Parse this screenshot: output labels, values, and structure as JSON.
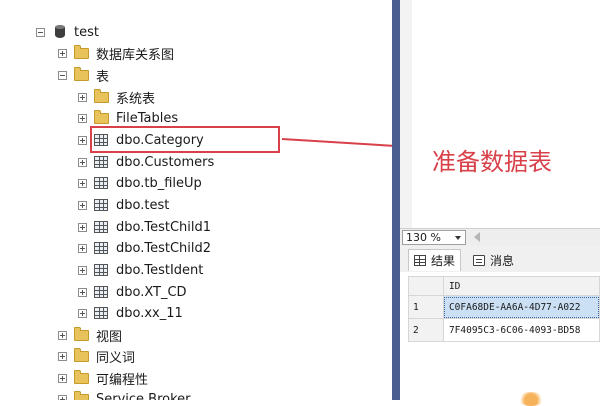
{
  "tree": {
    "database": "test",
    "nodes": [
      {
        "label": "数据库关系图",
        "icon": "folder-icon",
        "state": "collapsed"
      },
      {
        "label": "表",
        "icon": "folder-icon",
        "state": "expanded"
      },
      {
        "label": "系统表",
        "icon": "folder-icon",
        "state": "collapsed"
      },
      {
        "label": "FileTables",
        "icon": "folder-icon",
        "state": "collapsed"
      },
      {
        "label": "dbo.Category",
        "icon": "table-icon",
        "state": "collapsed"
      },
      {
        "label": "dbo.Customers",
        "icon": "table-icon",
        "state": "collapsed"
      },
      {
        "label": "dbo.tb_fileUp",
        "icon": "table-icon",
        "state": "collapsed"
      },
      {
        "label": "dbo.test",
        "icon": "table-icon",
        "state": "collapsed"
      },
      {
        "label": "dbo.TestChild1",
        "icon": "table-icon",
        "state": "collapsed"
      },
      {
        "label": "dbo.TestChild2",
        "icon": "table-icon",
        "state": "collapsed"
      },
      {
        "label": "dbo.TestIdent",
        "icon": "table-icon",
        "state": "collapsed"
      },
      {
        "label": "dbo.XT_CD",
        "icon": "table-icon",
        "state": "collapsed"
      },
      {
        "label": "dbo.xx_11",
        "icon": "table-icon",
        "state": "collapsed"
      },
      {
        "label": "视图",
        "icon": "folder-icon",
        "state": "collapsed"
      },
      {
        "label": "同义词",
        "icon": "folder-icon",
        "state": "collapsed"
      },
      {
        "label": "可编程性",
        "icon": "folder-icon",
        "state": "collapsed"
      },
      {
        "label": "Service Broker",
        "icon": "folder-icon",
        "state": "collapsed"
      }
    ]
  },
  "annotation": {
    "callout": "准备数据表",
    "colors": {
      "accent": "#d9414a"
    }
  },
  "editor": {
    "zoom": "130 %"
  },
  "results": {
    "tabs": {
      "results": "结果",
      "messages": "消息"
    },
    "column": "ID",
    "rows": [
      {
        "n": "1",
        "id": "C0FA68DE-AA6A-4D77-A022"
      },
      {
        "n": "2",
        "id": "7F4095C3-6C06-4093-BD58"
      }
    ]
  },
  "colors": {
    "splitter": "#4a5f8f",
    "selection": "#cce0f5"
  }
}
